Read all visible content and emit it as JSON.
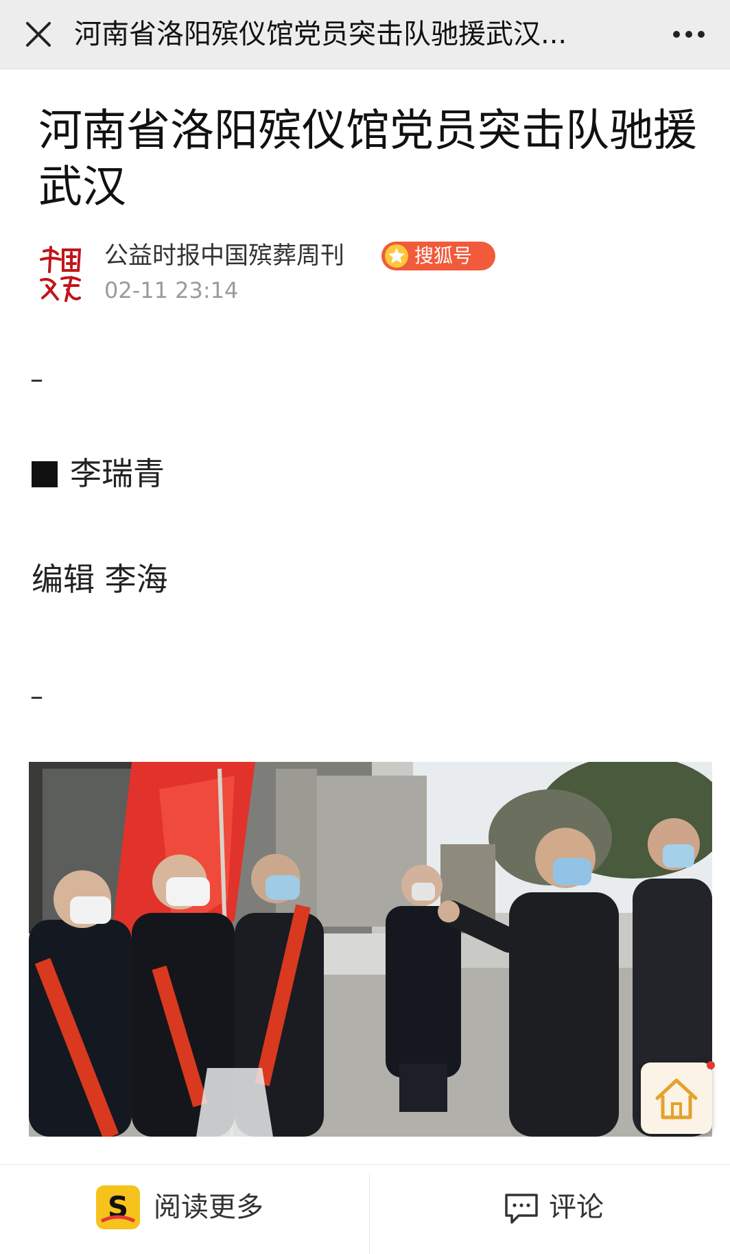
{
  "top_bar": {
    "title": "河南省洛阳殡仪馆党员突击队驰援武汉...",
    "close_icon": "close-icon",
    "more_icon": "more-icon"
  },
  "article": {
    "title": "河南省洛阳殡仪馆党员突击队驰援武汉",
    "source": {
      "name": "公益时报中国殡葬周刊",
      "badge": "搜狐号",
      "date": "02-11 23:14"
    },
    "body": {
      "dash_1": "–",
      "author": "李瑞青",
      "editor": "编辑 李海",
      "dash_2": "–"
    }
  },
  "bottom_bar": {
    "read_more_label": "阅读更多",
    "comment_label": "评论"
  },
  "colors": {
    "top_bar_bg": "#ededed",
    "badge": "#f15a3b",
    "date": "#9a9a9a"
  }
}
